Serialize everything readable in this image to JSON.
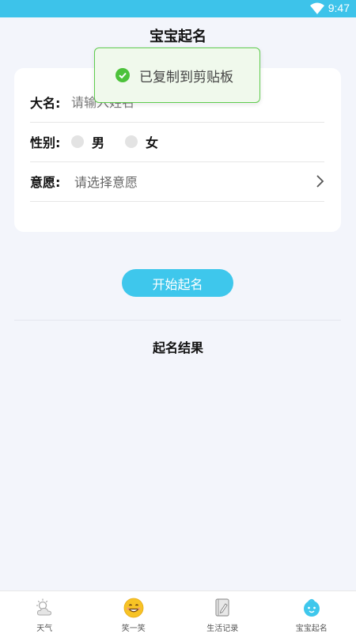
{
  "status_bar": {
    "time": "9:47",
    "icons": [
      "wifi-icon"
    ]
  },
  "page": {
    "title": "宝宝起名"
  },
  "form": {
    "name_label": "大名:",
    "name_placeholder": "请输入姓名",
    "gender_label": "性别:",
    "gender_options": [
      "男",
      "女"
    ],
    "wish_label": "意愿:",
    "wish_placeholder": "请选择意愿"
  },
  "start_button": "开始起名",
  "results": {
    "title": "起名结果"
  },
  "toast": {
    "message": "已复制到剪贴板",
    "icon": "check-circle-icon",
    "color": "#5fcc4e"
  },
  "accent_color": "#3ec7ec",
  "tabs": [
    {
      "label": "天气",
      "icon": "weather-icon",
      "active": false
    },
    {
      "label": "笑一笑",
      "icon": "smile-icon",
      "active": false
    },
    {
      "label": "生活记录",
      "icon": "notebook-icon",
      "active": false
    },
    {
      "label": "宝宝起名",
      "icon": "baby-icon",
      "active": true
    }
  ]
}
